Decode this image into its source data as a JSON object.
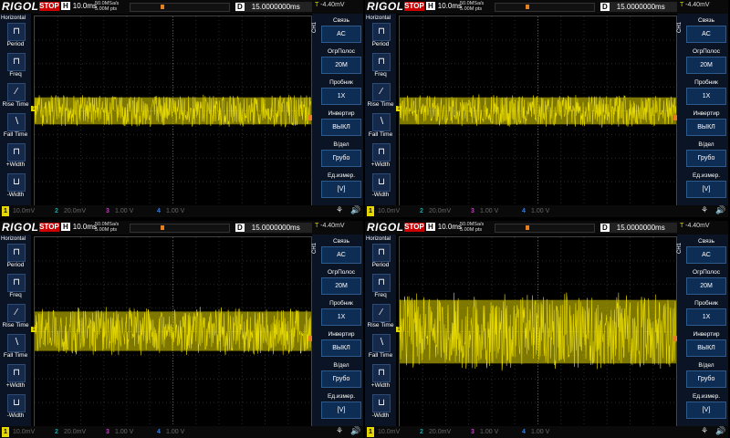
{
  "scopes": [
    {
      "top": {
        "logo": "RIGOL",
        "status": "STOP",
        "h_label": "H",
        "h_value": "10.0ms",
        "sample_rate": "50.0MSa/s",
        "points": "5.00M pts",
        "d_label": "D",
        "d_value": "15.0000000ms",
        "trigger_mark": "T",
        "trigger_value": "-4.40mV"
      },
      "trace": {
        "amplitude": 0.18
      }
    },
    {
      "top": {
        "logo": "RIGOL",
        "status": "STOP",
        "h_label": "H",
        "h_value": "10.0ms",
        "sample_rate": "50.0MSa/s",
        "points": "5.00M pts",
        "d_label": "D",
        "d_value": "15.0000000ms",
        "trigger_mark": "T",
        "trigger_value": "-4.40mV"
      },
      "trace": {
        "amplitude": 0.18
      }
    },
    {
      "top": {
        "logo": "RIGOL",
        "status": "STOP",
        "h_label": "H",
        "h_value": "10.0ms",
        "sample_rate": "50.0MSa/s",
        "points": "5.00M pts",
        "d_label": "D",
        "d_value": "15.0000000ms",
        "trigger_mark": "T",
        "trigger_value": "-4.40mV"
      },
      "trace": {
        "amplitude": 0.26
      }
    },
    {
      "top": {
        "logo": "RIGOL",
        "status": "STOP",
        "h_label": "H",
        "h_value": "10.0ms",
        "sample_rate": "50.0MSa/s",
        "points": "5.00M pts",
        "d_label": "D",
        "d_value": "15.0000000ms",
        "trigger_mark": "T",
        "trigger_value": "-4.40mV"
      },
      "trace": {
        "amplitude": 0.42
      }
    }
  ],
  "left_menu": {
    "title": "Horizontal",
    "items": [
      {
        "label": "Period",
        "icon": "period-icon"
      },
      {
        "label": "Freq",
        "icon": "freq-icon"
      },
      {
        "label": "Rise Time",
        "icon": "rise-time-icon"
      },
      {
        "label": "Fall Time",
        "icon": "fall-time-icon"
      },
      {
        "label": "+Width",
        "icon": "pos-width-icon"
      },
      {
        "label": "-Width",
        "icon": "neg-width-icon"
      }
    ]
  },
  "right_menu": {
    "channel": "CH1",
    "items": [
      {
        "title": "Связь",
        "value": "AC"
      },
      {
        "title": "ОгрПолос",
        "value": "20M"
      },
      {
        "title": "Пробник",
        "value": "1X"
      },
      {
        "title": "Инвертир",
        "value": "ВЫКЛ"
      },
      {
        "title": "В/дел",
        "value": "Грубо"
      },
      {
        "title": "Ед.измер.",
        "value": "[V]"
      }
    ]
  },
  "bottom": {
    "ch1": {
      "n": "1",
      "v": "10.0mV"
    },
    "ch2": {
      "n": "2",
      "v": "20.0mV"
    },
    "ch3": {
      "n": "3",
      "v": "1.00 V"
    },
    "ch4": {
      "n": "4",
      "v": "1.00 V"
    }
  },
  "colors": {
    "trace": "#e5d800",
    "trigger": "#e67e22",
    "menu_bg": "#0b1424"
  }
}
